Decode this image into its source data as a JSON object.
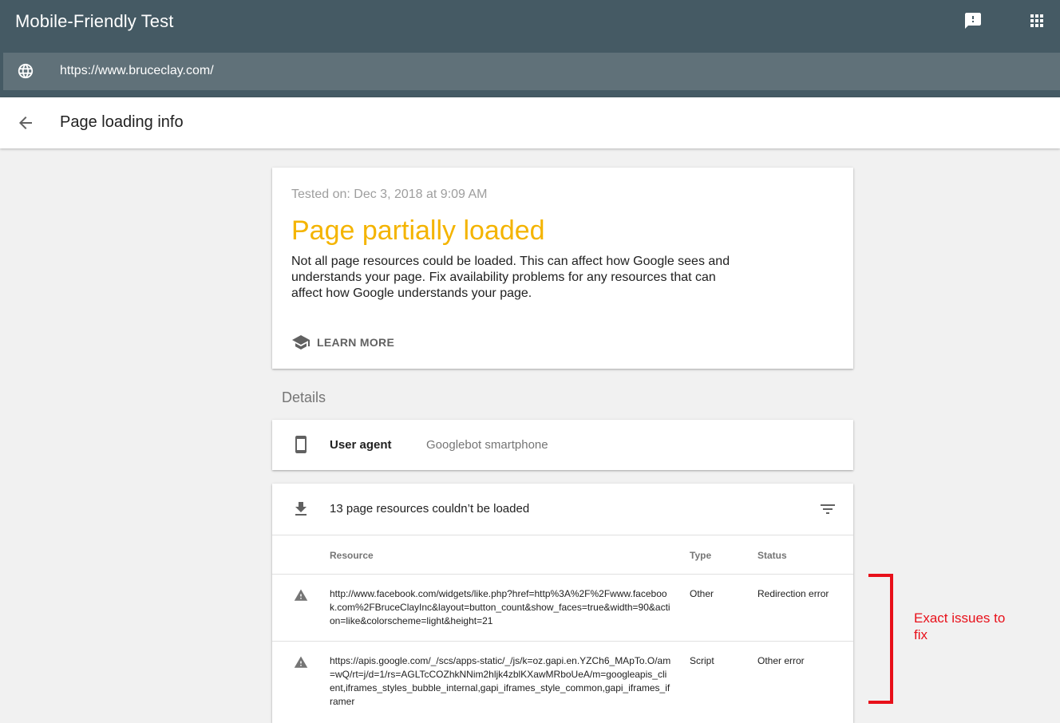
{
  "app": {
    "title": "Mobile-Friendly Test",
    "url": "https://www.bruceclay.com/",
    "icons": [
      "feedback-icon",
      "apps-grid-icon",
      "globe-icon"
    ]
  },
  "subheader": {
    "title": "Page loading info",
    "back_icon": "arrow-back-icon"
  },
  "summary": {
    "tested_on": "Tested on: Dec 3, 2018 at 9:09 AM",
    "status_title": "Page partially loaded",
    "status_color": "#f4b400",
    "description": "Not all page resources could be loaded. This can affect how Google sees and understands your page. Fix availability problems for any resources that can affect how Google understands your page.",
    "learn_more": "LEARN MORE",
    "learn_more_icon": "school-icon"
  },
  "details": {
    "label": "Details",
    "user_agent_label": "User agent",
    "user_agent_value": "Googlebot smartphone",
    "user_agent_icon": "smartphone-icon"
  },
  "resources": {
    "summary": "13 page resources couldn’t be loaded",
    "columns": {
      "resource": "Resource",
      "type": "Type",
      "status": "Status"
    },
    "rows": [
      {
        "resource": "http://www.facebook.com/widgets/like.php?href=http%3A%2F%2Fwww.facebook.com%2FBruceClayInc&layout=button_count&show_faces=true&width=90&action=like&colorscheme=light&height=21",
        "type": "Other",
        "status": "Redirection error"
      },
      {
        "resource": "https://apis.google.com/_/scs/apps-static/_/js/k=oz.gapi.en.YZCh6_MApTo.O/am=wQ/rt=j/d=1/rs=AGLTcCOZhkNNim2hljk4zblKXawMRboUeA/m=googleapis_client,iframes_styles_bubble_internal,gapi_iframes_style_common,gapi_iframes_iframer",
        "type": "Script",
        "status": "Other error"
      }
    ]
  },
  "annotation": {
    "text": "Exact issues to fix",
    "color": "#e8101a"
  }
}
